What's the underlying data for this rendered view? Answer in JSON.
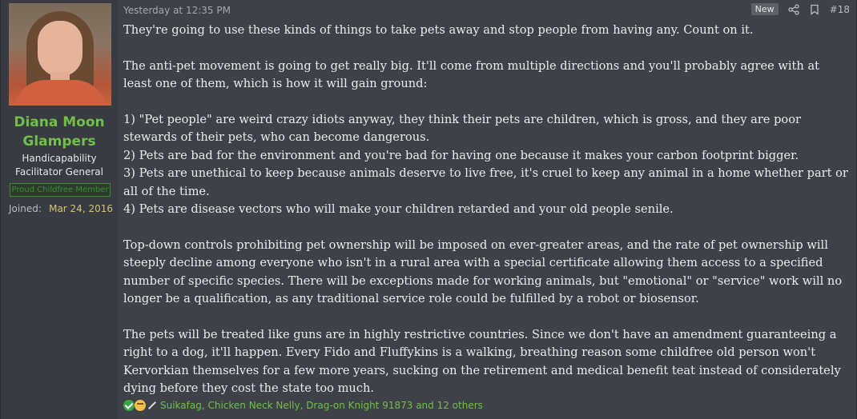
{
  "user": {
    "name": "Diana Moon Glampers",
    "title": "Handicapability Facilitator General",
    "banner": "Proud Childfree Member",
    "joined_label": "Joined:",
    "joined_date": "Mar 24, 2016"
  },
  "post": {
    "timestamp": "Yesterday at 12:35 PM",
    "new_badge": "New",
    "number": "#18",
    "paragraphs": [
      "They're going to use these kinds of things to take pets away and stop people from having any. Count on it.",
      "",
      "The anti-pet movement is going to get really big. It'll come from multiple directions and you'll probably agree with at least one of them, which is how it will gain ground:",
      "",
      "1) \"Pet people\" are weird crazy idiots anyway, they think their pets are children, which is gross, and they are poor stewards of their pets, who can become dangerous.",
      "2) Pets are bad for the environment and you're bad for having one because it makes your carbon footprint bigger.",
      "3) Pets are unethical to keep because animals deserve to live free, it's cruel to keep any animal in a home whether part or all of the time.",
      "4) Pets are disease vectors who will make your children retarded and your old people senile.",
      "",
      "Top-down controls prohibiting pet ownership will be imposed on ever-greater areas, and the rate of pet ownership will steeply decline among everyone who isn't in a rural area with a special certificate allowing them access to a specified number of specific species. There will be exceptions made for working animals, but \"emotional\" or \"service\" work will no longer be a qualification, as any traditional service role could be fulfilled by a robot or biosensor.",
      "",
      "The pets will be treated like guns are in highly restrictive countries. Since we don't have an amendment guaranteeing a right to a dog, it'll happen. Every Fido and Fluffykins is a walking, breathing reason some childfree old person won't Kervorkian themselves for a few more years, sucking on the retirement and medical benefit teat instead of considerately dying before they cost the state too much."
    ]
  },
  "reactions": {
    "icons": [
      "check-icon",
      "thinking-icon",
      "wand-icon"
    ],
    "text": "Suikafag, Chicken Neck Nelly, Drag-on Knight 91873 and 12 others"
  },
  "colors": {
    "username": "#6fbf4a",
    "joined_date": "#d7c27a",
    "background": "#3e4248"
  }
}
